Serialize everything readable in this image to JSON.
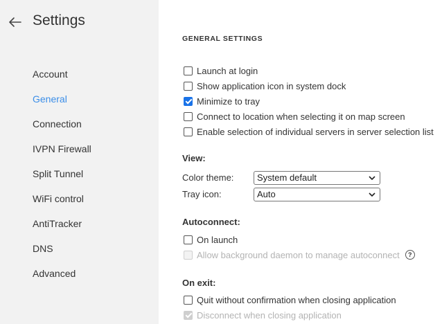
{
  "sidebar": {
    "title": "Settings",
    "items": [
      {
        "label": "Account"
      },
      {
        "label": "General",
        "active": true
      },
      {
        "label": "Connection"
      },
      {
        "label": "IVPN Firewall"
      },
      {
        "label": "Split Tunnel"
      },
      {
        "label": "WiFi control"
      },
      {
        "label": "AntiTracker"
      },
      {
        "label": "DNS"
      },
      {
        "label": "Advanced"
      }
    ]
  },
  "main": {
    "section_title": "GENERAL SETTINGS",
    "options": [
      {
        "label": "Launch at login",
        "checked": false
      },
      {
        "label": "Show application icon in system dock",
        "checked": false
      },
      {
        "label": "Minimize to tray",
        "checked": true
      },
      {
        "label": "Connect to location when selecting it on map screen",
        "checked": false
      },
      {
        "label": "Enable selection of individual servers in server selection list",
        "checked": false
      }
    ],
    "view": {
      "label": "View:",
      "color_theme_label": "Color theme:",
      "color_theme_value": "System default",
      "tray_icon_label": "Tray icon:",
      "tray_icon_value": "Auto"
    },
    "autoconnect": {
      "label": "Autoconnect:",
      "on_launch": "On launch",
      "background_daemon": "Allow background daemon to manage autoconnect",
      "help_glyph": "?"
    },
    "on_exit": {
      "label": "On exit:",
      "quit_without_confirmation": "Quit without confirmation when closing application",
      "disconnect_when_closing": "Disconnect when closing application"
    }
  },
  "colors": {
    "sidebar_bg": "#f2f2f2",
    "accent": "#3b8ee8",
    "checkbox_checked": "#1a73e8",
    "disabled_text": "#b3b3b3"
  }
}
